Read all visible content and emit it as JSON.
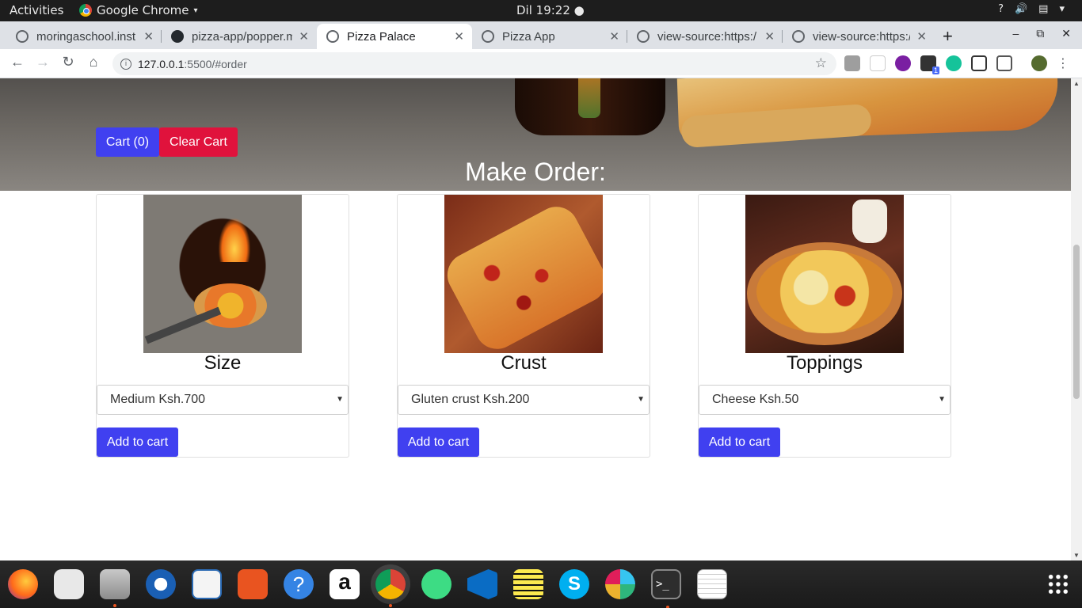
{
  "system_bar": {
    "activities": "Activities",
    "app_menu": "Google Chrome",
    "clock": "Dil 19:22 ●",
    "tray_icons": [
      "help-icon",
      "volume-icon",
      "clipboard-icon",
      "power-icon"
    ],
    "help_glyph": "?",
    "volume_glyph": "🔊",
    "clipboard_glyph": "▤",
    "caret_glyph": "▾"
  },
  "tabs": [
    {
      "title": "moringaschool.inst",
      "favicon": "globe-icon"
    },
    {
      "title": "pizza-app/popper.m",
      "favicon": "github-icon"
    },
    {
      "title": "Pizza Palace",
      "favicon": "globe-icon",
      "active": true
    },
    {
      "title": "Pizza App",
      "favicon": "globe-icon"
    },
    {
      "title": "view-source:https:/",
      "favicon": "globe-icon"
    },
    {
      "title": "view-source:https:/",
      "favicon": "globe-icon"
    }
  ],
  "tab_close_glyph": "✕",
  "new_tab_glyph": "+",
  "window_controls": {
    "minimize": "–",
    "restore": "⧉",
    "close": "✕"
  },
  "toolbar": {
    "back": "←",
    "forward": "→",
    "reload": "↻",
    "home": "⌂",
    "url_host": "127.0.0.1",
    "url_rest": ":5500/#order",
    "info_glyph": "i",
    "star": "☆",
    "extension_badge": "1"
  },
  "page": {
    "cart_button": "Cart (0)",
    "clear_button": "Clear Cart",
    "heading": "Make Order:",
    "cards": [
      {
        "label": "Size",
        "selected": "Medium Ksh.700",
        "add_button": "Add to cart",
        "image": "pizza-oven-image"
      },
      {
        "label": "Crust",
        "selected": "Gluten crust Ksh.200",
        "add_button": "Add to cart",
        "image": "flatbread-pizza-image"
      },
      {
        "label": "Toppings",
        "selected": "Cheese Ksh.50",
        "add_button": "Add to cart",
        "image": "cheese-pizza-image"
      }
    ],
    "select_arrow": "▼",
    "accent_color": "#4040f0",
    "danger_color": "#e0123c"
  },
  "scrollbar": {
    "up": "▲",
    "down": "▼"
  },
  "dock": {
    "items": [
      "firefox-icon",
      "rhythmbox-icon",
      "files-icon",
      "thunderbird-icon",
      "libreoffice-writer-icon",
      "software-center-icon",
      "help-icon",
      "amazon-icon",
      "chrome-icon",
      "android-studio-icon",
      "vscode-icon",
      "notes-icon",
      "skype-icon",
      "slack-icon",
      "terminal-icon",
      "text-editor-icon"
    ],
    "help_glyph": "?",
    "amazon_glyph": "a",
    "skype_glyph": "S",
    "terminal_glyph": ">_"
  }
}
